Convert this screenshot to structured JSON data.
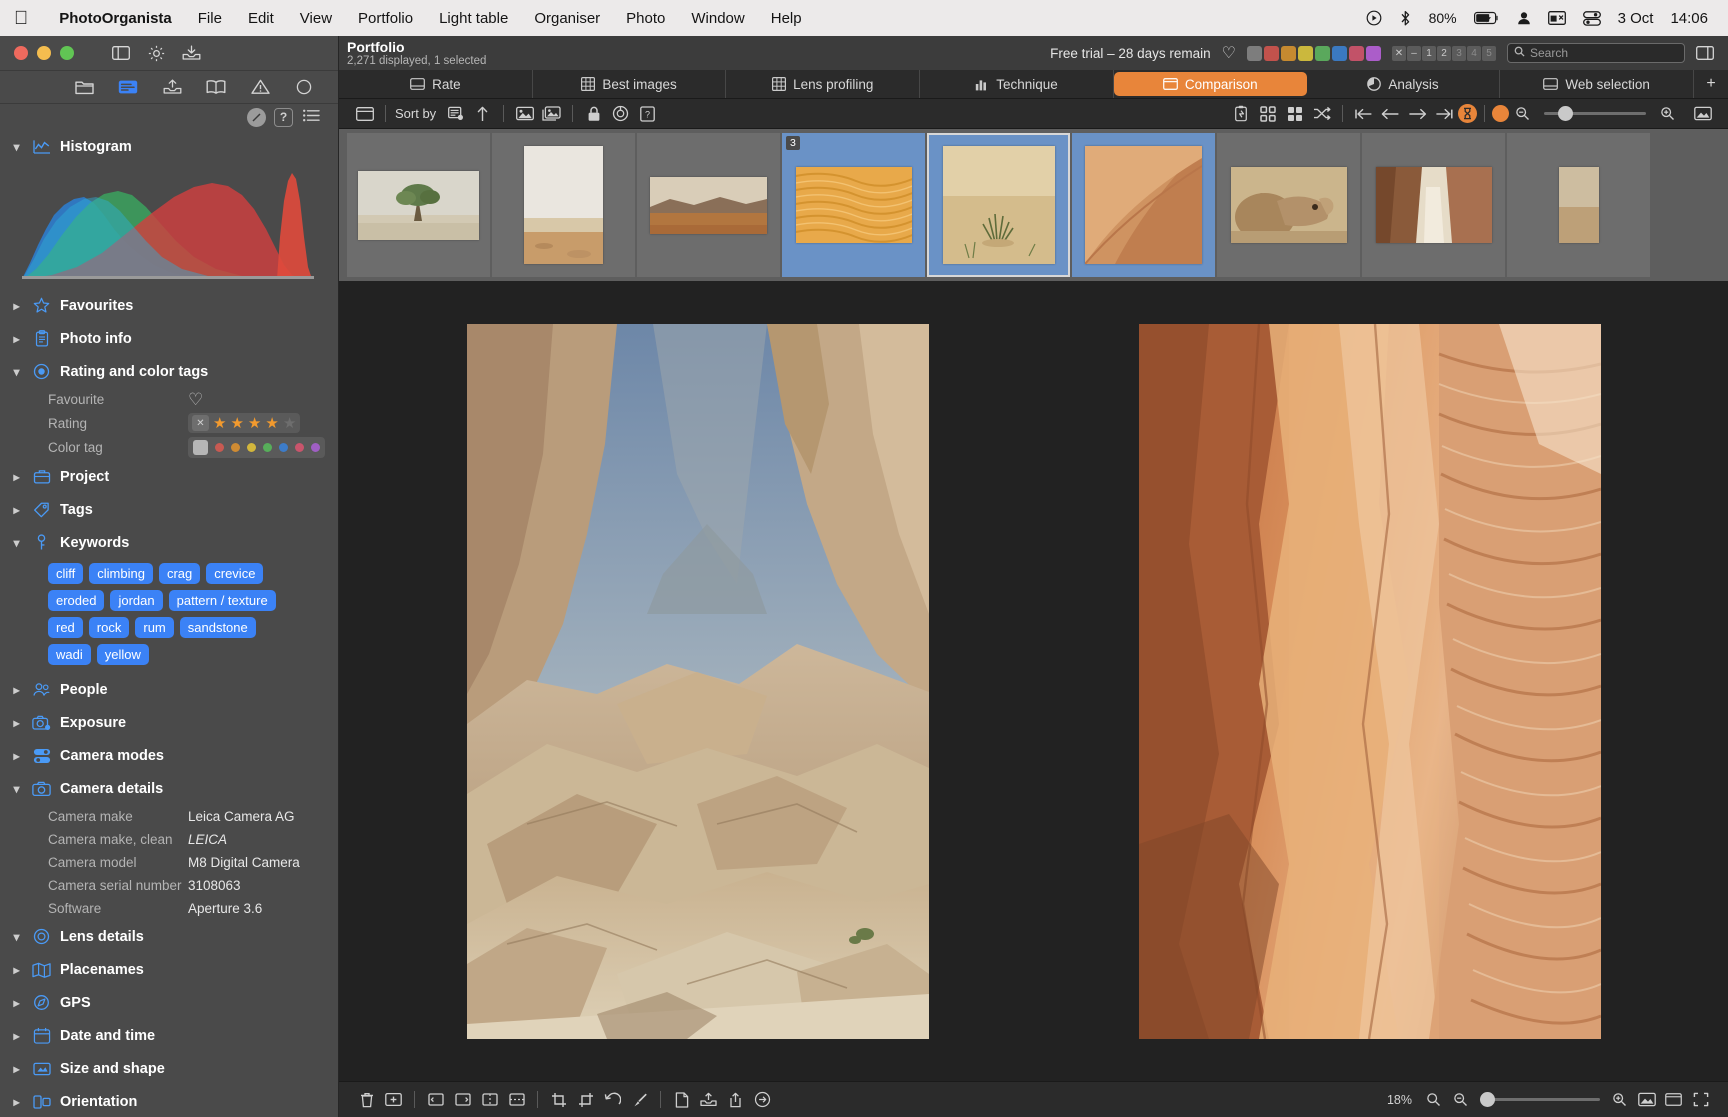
{
  "menubar": {
    "apple": "apple-logo",
    "app_name": "PhotoOrganista",
    "items": [
      "File",
      "Edit",
      "View",
      "Portfolio",
      "Light table",
      "Organiser",
      "Photo",
      "Window",
      "Help"
    ],
    "battery_percent": "80%",
    "date": "3 Oct",
    "time": "14:06",
    "status_icons": [
      "play-circle-icon",
      "bluetooth-icon",
      "battery-charging-icon",
      "user-icon",
      "screen-icon",
      "control-center-icon"
    ]
  },
  "sidebar": {
    "window_icons": [
      "panel-toggle-icon",
      "gear-icon",
      "import-icon"
    ],
    "tabs": [
      "folder-icon",
      "metadata-icon",
      "export-icon",
      "book-icon",
      "warning-icon",
      "circle-icon"
    ],
    "tool_icons": [
      "edit-pencil-icon",
      "help-icon",
      "list-icon"
    ],
    "sections": [
      {
        "key": "histogram",
        "label": "Histogram",
        "icon": "histogram-icon",
        "expanded": true
      },
      {
        "key": "favourites",
        "label": "Favourites",
        "icon": "star-icon",
        "expanded": false
      },
      {
        "key": "photo_info",
        "label": "Photo info",
        "icon": "clipboard-icon",
        "expanded": false
      },
      {
        "key": "rating_color",
        "label": "Rating and color tags",
        "icon": "badge-icon",
        "expanded": true
      },
      {
        "key": "project",
        "label": "Project",
        "icon": "briefcase-icon",
        "expanded": false
      },
      {
        "key": "tags",
        "label": "Tags",
        "icon": "tag-icon",
        "expanded": false
      },
      {
        "key": "keywords",
        "label": "Keywords",
        "icon": "key-icon",
        "expanded": true
      },
      {
        "key": "people",
        "label": "People",
        "icon": "people-icon",
        "expanded": false
      },
      {
        "key": "exposure",
        "label": "Exposure",
        "icon": "exposure-icon",
        "expanded": false
      },
      {
        "key": "camera_modes",
        "label": "Camera modes",
        "icon": "camera-modes-icon",
        "expanded": false
      },
      {
        "key": "camera_details",
        "label": "Camera details",
        "icon": "camera-icon",
        "expanded": true
      },
      {
        "key": "lens_details",
        "label": "Lens details",
        "icon": "lens-icon",
        "expanded": true
      },
      {
        "key": "placenames",
        "label": "Placenames",
        "icon": "map-icon",
        "expanded": false
      },
      {
        "key": "gps",
        "label": "GPS",
        "icon": "gps-icon",
        "expanded": false
      },
      {
        "key": "date_time",
        "label": "Date and time",
        "icon": "calendar-icon",
        "expanded": false
      },
      {
        "key": "size_shape",
        "label": "Size and shape",
        "icon": "size-icon",
        "expanded": false
      },
      {
        "key": "orientation",
        "label": "Orientation",
        "icon": "orientation-icon",
        "expanded": false
      }
    ],
    "rating_rows": {
      "favourite_label": "Favourite",
      "rating_label": "Rating",
      "color_tag_label": "Color tag",
      "rating_value": 4,
      "rating_max": 5,
      "color_tag_colors": [
        "#c85a52",
        "#cf8b33",
        "#d2b63c",
        "#57ae5a",
        "#3d7cc9",
        "#c9556c",
        "#a05fc4"
      ]
    },
    "keywords": [
      "cliff",
      "climbing",
      "crag",
      "crevice",
      "eroded",
      "jordan",
      "pattern / texture",
      "red",
      "rock",
      "rum",
      "sandstone",
      "wadi",
      "yellow"
    ],
    "camera_details": [
      {
        "key": "Camera make",
        "value": "Leica Camera AG",
        "italic": false
      },
      {
        "key": "Camera make, clean",
        "value": "LEICA",
        "italic": true
      },
      {
        "key": "Camera model",
        "value": "M8 Digital Camera",
        "italic": false
      },
      {
        "key": "Camera serial number",
        "value": "3108063",
        "italic": false
      },
      {
        "key": "Software",
        "value": "Aperture 3.6",
        "italic": false
      }
    ]
  },
  "header": {
    "title": "Portfolio",
    "subtitle": "2,271 displayed, 1 selected",
    "trial": "Free trial – 28 days remain",
    "swatch_colors": [
      "#7d7d7d",
      "#c2524c",
      "#c68a30",
      "#cbb83d",
      "#5aa85c",
      "#3b79c0",
      "#c25268",
      "#ab5dc9"
    ],
    "rate_boxes": [
      "✕",
      "–",
      "1",
      "2",
      "3",
      "4",
      "5"
    ],
    "search_placeholder": "Search"
  },
  "tabs": [
    {
      "label": "Rate",
      "icon": "rate-icon",
      "active": false
    },
    {
      "label": "Best images",
      "icon": "grid-icon",
      "active": false
    },
    {
      "label": "Lens profiling",
      "icon": "grid-icon",
      "active": false
    },
    {
      "label": "Technique",
      "icon": "bars-icon",
      "active": false
    },
    {
      "label": "Comparison",
      "icon": "compare-icon",
      "active": true
    },
    {
      "label": "Analysis",
      "icon": "pie-icon",
      "active": false
    },
    {
      "label": "Web selection",
      "icon": "web-icon",
      "active": false
    }
  ],
  "toolbar": {
    "sort_by_label": "Sort by",
    "left_icons": [
      "layout-icon",
      "sort-field-icon",
      "sort-asc-arrow-icon",
      "image-icon",
      "stack-icon",
      "lock-icon",
      "target-icon",
      "question-box-icon"
    ],
    "center_icons": [
      "filmstrip-icon",
      "grid-4-icon",
      "grid-2-icon",
      "shuffle-icon",
      "first-icon",
      "prev-icon",
      "next-icon",
      "last-icon",
      "pin-icon",
      "dot-icon"
    ],
    "right_icons": [
      "zoom-out-icon",
      "zoom-in-icon",
      "fullscreen-icon"
    ],
    "zoom_slider_value": 18
  },
  "filmstrip": [
    {
      "name": "desert-tree",
      "selected": false,
      "badge": null
    },
    {
      "name": "hazy-desert",
      "selected": false,
      "badge": null
    },
    {
      "name": "distant-dunes",
      "selected": false,
      "badge": null
    },
    {
      "name": "orange-dune-ripples",
      "selected": true,
      "current": false,
      "badge": "3"
    },
    {
      "name": "dune-grass",
      "selected": true,
      "current": true,
      "badge": null
    },
    {
      "name": "dune-ridge",
      "selected": true,
      "current": false,
      "badge": null
    },
    {
      "name": "camel-portrait",
      "selected": false,
      "badge": null
    },
    {
      "name": "slot-canyon",
      "selected": false,
      "badge": null
    },
    {
      "name": "partial-thumb",
      "selected": false,
      "badge": null
    }
  ],
  "viewer": {
    "left_image": "wadi-rum-canyon",
    "right_image": "red-sandstone-wall"
  },
  "bottombar": {
    "icons": [
      "trash-icon",
      "add-album-icon",
      "rotate-left-icon",
      "rotate-right-icon",
      "flip-h-icon",
      "flip-v-icon",
      "crop-icon",
      "crop-alt-icon",
      "undo-icon",
      "brush-icon",
      "document-icon",
      "upload-icon",
      "share-icon",
      "arrow-right-icon"
    ],
    "zoom_percent": "18%",
    "right_icons": [
      "zoom-out-icon",
      "zoom-in-icon",
      "fit-icon",
      "screen-icon",
      "actual-size-icon"
    ]
  }
}
